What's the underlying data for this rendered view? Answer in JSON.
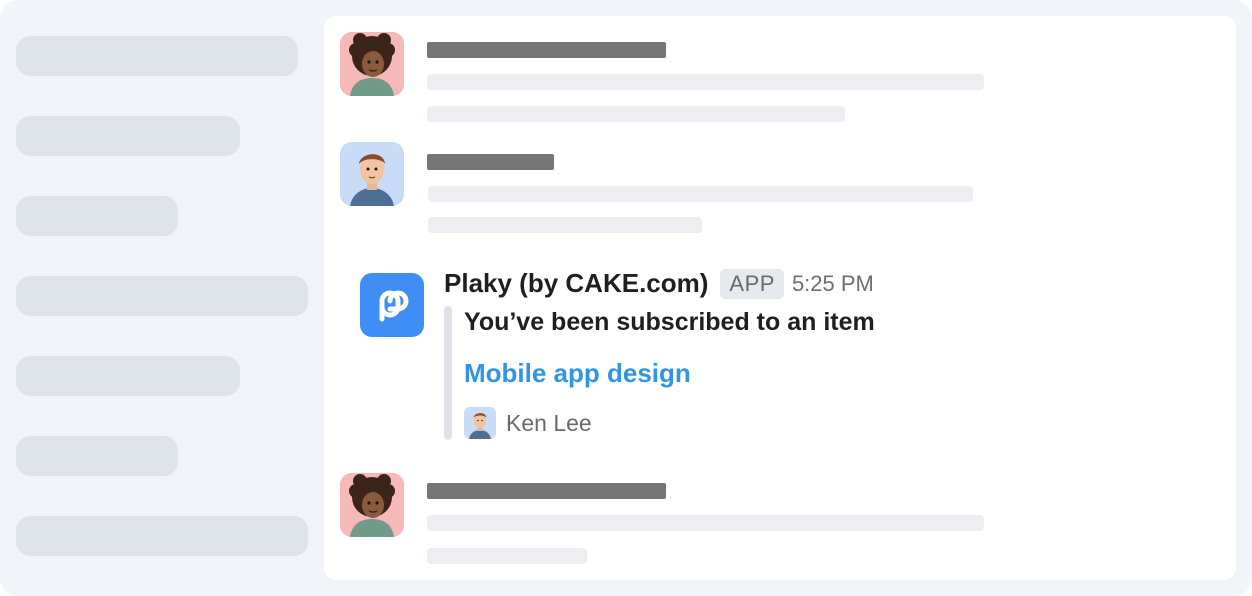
{
  "colors": {
    "background": "#f1f4f8",
    "panel": "#ffffff",
    "skeleton_sidebar": "#dfe4ea",
    "skeleton_name": "#757575",
    "skeleton_line": "#eceef2",
    "app_accent": "#3f8ef5",
    "link": "#2e95e8"
  },
  "notification": {
    "app_icon": "plaky-logo-icon",
    "sender": "Plaky (by CAKE.com)",
    "badge": "APP",
    "time": "5:25 PM",
    "title": "You’ve been subscribed to an item",
    "item_link": "Mobile app design",
    "user": {
      "avatar": "man-avatar-icon",
      "name": "Ken Lee"
    }
  },
  "messages": [
    {
      "avatar": "woman-curly-hair-avatar-icon"
    },
    {
      "avatar": "man-avatar-icon"
    },
    {
      "avatar": "woman-curly-hair-avatar-icon"
    }
  ]
}
